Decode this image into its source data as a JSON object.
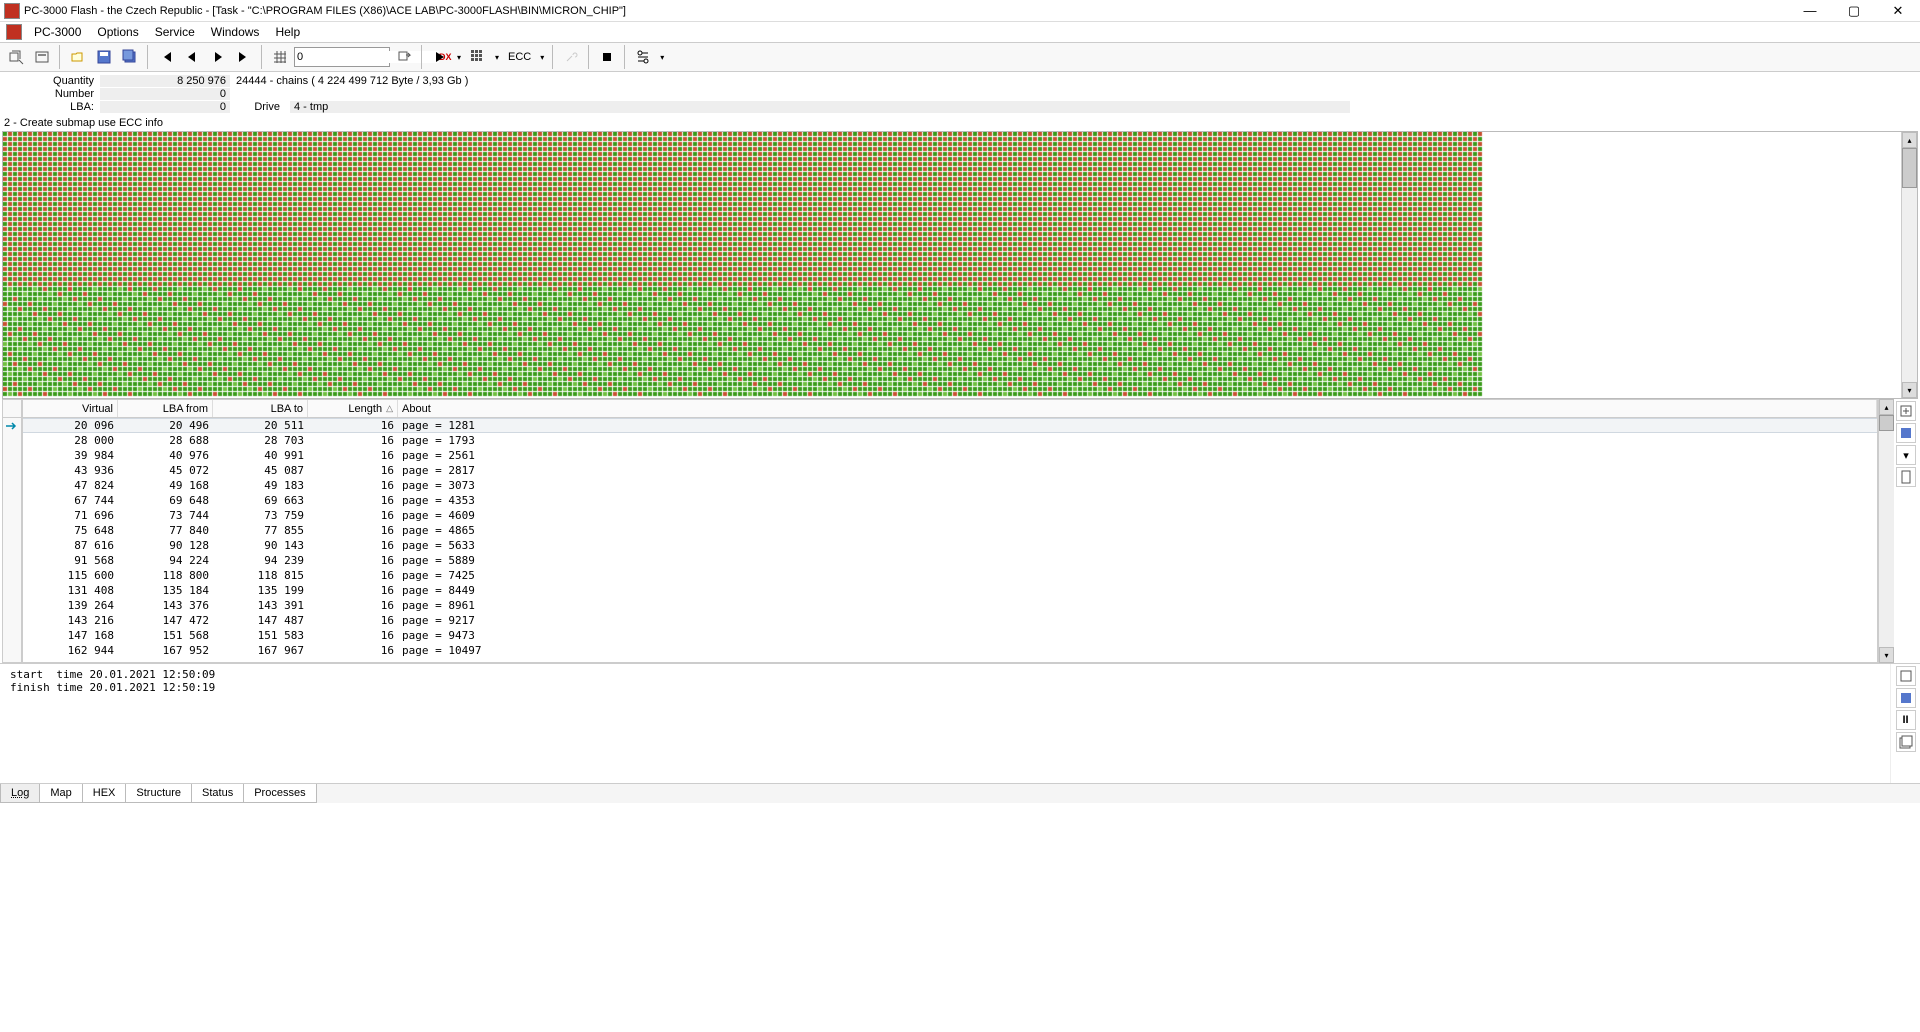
{
  "title": "PC-3000 Flash - the Czech Republic - [Task - \"C:\\PROGRAM FILES (X86)\\ACE LAB\\PC-3000FLASH\\BIN\\MICRON_CHIP\"]",
  "menu": {
    "app": "PC-3000",
    "options": "Options",
    "service": "Service",
    "windows": "Windows",
    "help": "Help"
  },
  "toolbar": {
    "input_value": "0",
    "ecc": "ECC"
  },
  "info": {
    "quantity_label": "Quantity",
    "quantity_val": "8 250 976",
    "chains_text": "24444 - chains  ( 4 224 499 712 Byte /  3,93 Gb )",
    "number_label": "Number",
    "number_val": "0",
    "lba_label": "LBA:",
    "lba_val": "0",
    "drive_label": "Drive",
    "drive_val": "4 - tmp"
  },
  "section_title": "2 - Create submap use ECC info",
  "table": {
    "headers": {
      "virtual": "Virtual",
      "lba_from": "LBA from",
      "lba_to": "LBA to",
      "length": "Length",
      "about": "About"
    },
    "rows": [
      {
        "virtual": "20 096",
        "from": "20 496",
        "to": "20 511",
        "len": "16",
        "about": "page = 1281"
      },
      {
        "virtual": "28 000",
        "from": "28 688",
        "to": "28 703",
        "len": "16",
        "about": "page = 1793"
      },
      {
        "virtual": "39 984",
        "from": "40 976",
        "to": "40 991",
        "len": "16",
        "about": "page = 2561"
      },
      {
        "virtual": "43 936",
        "from": "45 072",
        "to": "45 087",
        "len": "16",
        "about": "page = 2817"
      },
      {
        "virtual": "47 824",
        "from": "49 168",
        "to": "49 183",
        "len": "16",
        "about": "page = 3073"
      },
      {
        "virtual": "67 744",
        "from": "69 648",
        "to": "69 663",
        "len": "16",
        "about": "page = 4353"
      },
      {
        "virtual": "71 696",
        "from": "73 744",
        "to": "73 759",
        "len": "16",
        "about": "page = 4609"
      },
      {
        "virtual": "75 648",
        "from": "77 840",
        "to": "77 855",
        "len": "16",
        "about": "page = 4865"
      },
      {
        "virtual": "87 616",
        "from": "90 128",
        "to": "90 143",
        "len": "16",
        "about": "page = 5633"
      },
      {
        "virtual": "91 568",
        "from": "94 224",
        "to": "94 239",
        "len": "16",
        "about": "page = 5889"
      },
      {
        "virtual": "115 600",
        "from": "118 800",
        "to": "118 815",
        "len": "16",
        "about": "page = 7425"
      },
      {
        "virtual": "131 408",
        "from": "135 184",
        "to": "135 199",
        "len": "16",
        "about": "page = 8449"
      },
      {
        "virtual": "139 264",
        "from": "143 376",
        "to": "143 391",
        "len": "16",
        "about": "page = 8961"
      },
      {
        "virtual": "143 216",
        "from": "147 472",
        "to": "147 487",
        "len": "16",
        "about": "page = 9217"
      },
      {
        "virtual": "147 168",
        "from": "151 568",
        "to": "151 583",
        "len": "16",
        "about": "page = 9473"
      },
      {
        "virtual": "162 944",
        "from": "167 952",
        "to": "167 967",
        "len": "16",
        "about": "page = 10497"
      }
    ]
  },
  "log": "start  time 20.01.2021 12:50:09\nfinish time 20.01.2021 12:50:19",
  "tabs": {
    "log": "Log",
    "map": "Map",
    "hex": "HEX",
    "structure": "Structure",
    "status": "Status",
    "processes": "Processes"
  }
}
